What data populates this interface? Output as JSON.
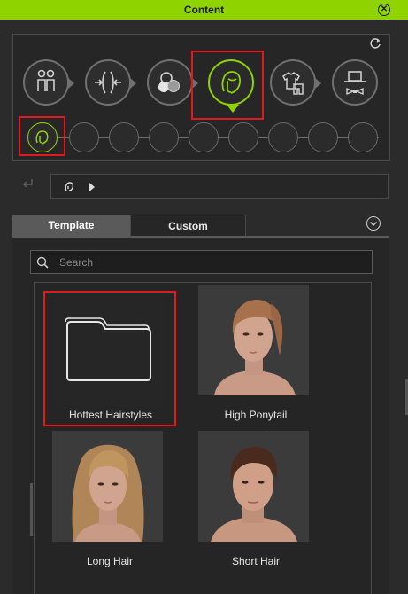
{
  "window": {
    "title": "Content"
  },
  "categories": [
    {
      "icon": "body-icon",
      "active": false
    },
    {
      "icon": "morph-icon",
      "active": false
    },
    {
      "icon": "material-icon",
      "active": false
    },
    {
      "icon": "hair-icon",
      "active": true
    },
    {
      "icon": "clothing-icon",
      "active": false
    },
    {
      "icon": "accessory-icon",
      "active": false
    }
  ],
  "subcategory_count": 9,
  "tabs": {
    "template": "Template",
    "custom": "Custom"
  },
  "search": {
    "placeholder": "Search",
    "value": ""
  },
  "items": [
    {
      "label": "Hottest Hairstyles",
      "type": "folder"
    },
    {
      "label": "High Ponytail",
      "type": "hair"
    },
    {
      "label": "Long Hair",
      "type": "hair"
    },
    {
      "label": "Short Hair",
      "type": "hair"
    }
  ],
  "colors": {
    "accent": "#8fd400",
    "highlight": "#e0191e",
    "background": "#2b2b2b"
  }
}
